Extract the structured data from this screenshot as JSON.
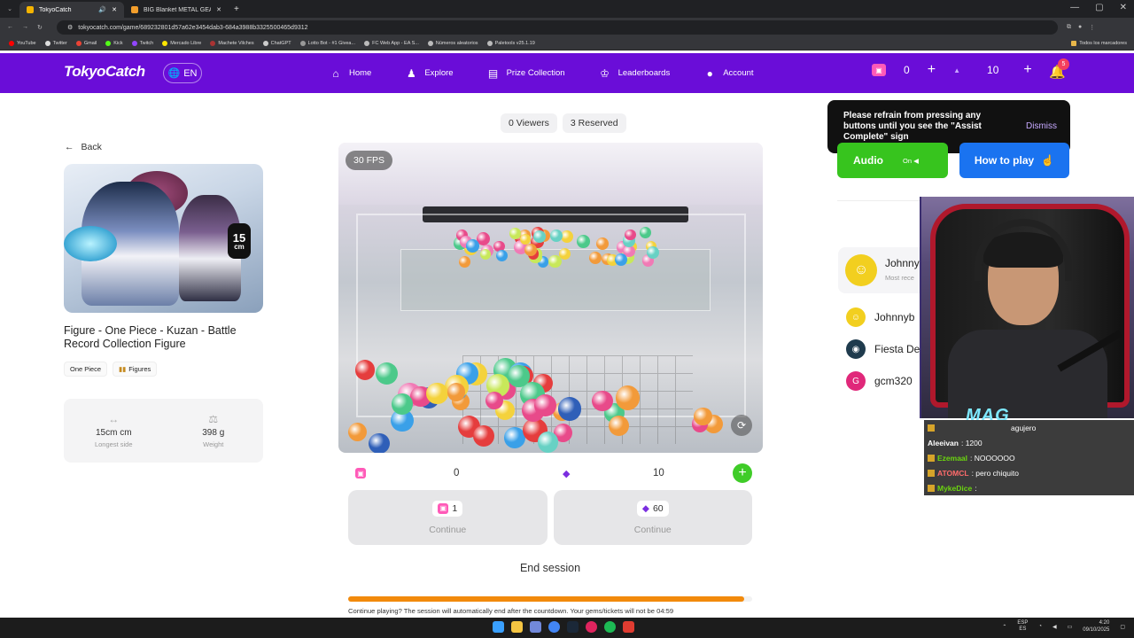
{
  "browser": {
    "tabs": [
      {
        "title": "TokyoCatch",
        "active": true,
        "color": "#f5b400"
      },
      {
        "title": "BIG Blanket METAL GEAR SOLID",
        "active": false,
        "color": "#f29e2c"
      }
    ],
    "url": "tokyocatch.com/game/689232801d57a62e3454dab3-684a3988b3325500465d9312",
    "bookmarks": [
      "YouTube",
      "Twitter",
      "Gmail",
      "Kick",
      "Twitch",
      "Mercado Libre",
      "Machete Vilches",
      "ChatGPT",
      "Lotto Bot - #1 Givea...",
      "FC Web App - EA S...",
      "Números aleatorios",
      "Paletools v25.1.19"
    ],
    "bookmarks_all": "Todos los marcadores"
  },
  "nav": {
    "logo": "TokyoCatch",
    "lang": "EN",
    "items": [
      {
        "label": "Home",
        "icon": "home-icon"
      },
      {
        "label": "Explore",
        "icon": "explore-icon"
      },
      {
        "label": "Prize Collection",
        "icon": "collection-icon"
      },
      {
        "label": "Leaderboards",
        "icon": "trophy-icon"
      },
      {
        "label": "Account",
        "icon": "user-icon"
      }
    ],
    "tickets": "0",
    "gems": "10",
    "notifications": "5"
  },
  "product": {
    "back": "Back",
    "size_value": "15",
    "size_unit": "cm",
    "title": "Figure - One Piece - Kuzan - Battle Record Collection Figure",
    "tags": [
      "One Piece",
      "Figures"
    ],
    "longest_side_value": "15cm cm",
    "longest_side_label": "Longest side",
    "weight_value": "398 g",
    "weight_label": "Weight"
  },
  "stream": {
    "viewers": "0 Viewers",
    "reserved": "3 Reserved",
    "fps": "30 FPS"
  },
  "balances": {
    "tickets": "0",
    "gems": "10"
  },
  "play": {
    "ticket_cost": "1",
    "gem_cost": "60",
    "continue_label": "Continue",
    "end_session": "End session",
    "countdown_fraction": 0.98,
    "note": "Continue playing? The session will automatically end after the countdown. Your gems/tickets will not be 04:59"
  },
  "toast": {
    "text": "Please refrain from pressing any buttons until you see the \"Assist Complete\" sign",
    "dismiss": "Dismiss"
  },
  "sidebar": {
    "audio": "Audio",
    "audio_state": "On",
    "how_to_play": "How to play",
    "winner_name": "Johnny",
    "winner_sub": "Most rece",
    "users": [
      {
        "name": "Johnnyb",
        "avatar_color": "#f2cf1f"
      },
      {
        "name": "Fiesta De",
        "avatar_color": "#1f3b4d"
      },
      {
        "name": "gcm320",
        "avatar_color": "#e0287a",
        "initial": "G"
      }
    ]
  },
  "overlay": {
    "cam_logo": "MAG",
    "chat": [
      {
        "user": "",
        "msg": "agujero",
        "color": "#ffffff"
      },
      {
        "user": "Aleeivan",
        "msg": ": 1200",
        "color": "#ffffff"
      },
      {
        "user": "Ezemaal",
        "msg": ": NOOOOOO",
        "color": "#6bd60f"
      },
      {
        "user": "ATOMCL",
        "msg": ": pero chiquito",
        "color": "#ff6b6b"
      },
      {
        "user": "MykeDice",
        "msg": ":",
        "color": "#6bd60f"
      }
    ]
  },
  "taskbar": {
    "lang1": "ESP",
    "lang2": "ES",
    "time": "4:20",
    "date": "09/10/2025"
  }
}
